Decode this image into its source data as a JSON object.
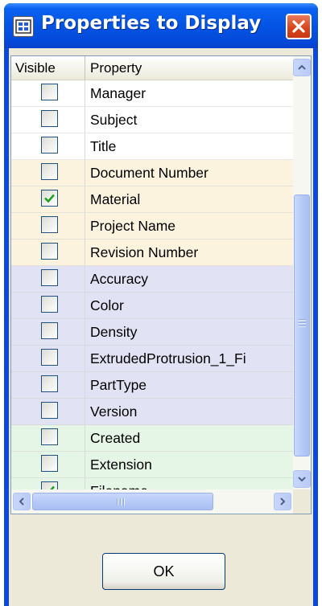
{
  "window": {
    "title": "Properties to Display"
  },
  "icons": {
    "app": "properties-app-icon",
    "close": "close-icon",
    "check": "checkmark-icon",
    "scroll_up": "chevron-up-icon",
    "scroll_down": "chevron-down-icon",
    "scroll_left": "chevron-left-icon",
    "scroll_right": "chevron-right-icon"
  },
  "columns": {
    "visible": "Visible",
    "property": "Property"
  },
  "group_colors": {
    "summary": "#ffffff",
    "custom": "#fbf3dd",
    "part": "#e2e2f5",
    "file": "#e6f6e6"
  },
  "rows": [
    {
      "label": "Manager",
      "checked": false,
      "group": "summary"
    },
    {
      "label": "Subject",
      "checked": false,
      "group": "summary"
    },
    {
      "label": "Title",
      "checked": false,
      "group": "summary"
    },
    {
      "label": "Document Number",
      "checked": false,
      "group": "custom"
    },
    {
      "label": "Material",
      "checked": true,
      "group": "custom"
    },
    {
      "label": "Project Name",
      "checked": false,
      "group": "custom"
    },
    {
      "label": "Revision Number",
      "checked": false,
      "group": "custom"
    },
    {
      "label": "Accuracy",
      "checked": false,
      "group": "part"
    },
    {
      "label": "Color",
      "checked": false,
      "group": "part"
    },
    {
      "label": "Density",
      "checked": false,
      "group": "part"
    },
    {
      "label": "ExtrudedProtrusion_1_Fi",
      "checked": false,
      "group": "part"
    },
    {
      "label": "PartType",
      "checked": false,
      "group": "part"
    },
    {
      "label": "Version",
      "checked": false,
      "group": "part"
    },
    {
      "label": "Created",
      "checked": false,
      "group": "file"
    },
    {
      "label": "Extension",
      "checked": false,
      "group": "file"
    },
    {
      "label": "Filename",
      "checked": true,
      "group": "file"
    }
  ],
  "buttons": {
    "ok": "OK"
  }
}
